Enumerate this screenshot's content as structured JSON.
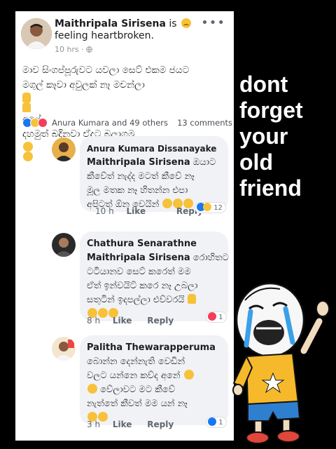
{
  "post": {
    "author": "Maithripala Sirisena",
    "feeling_prefix": "is",
    "feeling": "feeling heartbroken.",
    "time": "10 hrs · ",
    "more": "•••",
    "text_lines": [
      "මාව සිංගප්පූරුවට යවලා සෙට් එකම ජයට",
      "මගුල් කෑවා අවුලක් නෑ මචන්ලා",
      "දහමුත් බදිනවා ඒදට බලාගමු"
    ],
    "text_line2_tail": "අපේ",
    "reactors": "Anura Kumara and 49 others",
    "comment_count": "13 comments"
  },
  "comments": [
    {
      "author": "Anura Kumara Dissanayake",
      "tag": "Maithripala Sirisena",
      "tag_tail": "ඔයාට",
      "lines": [
        "කීවේත් නැද්ද මටත් කීවේ නෑ",
        "මූල මතක නෑ හිතන්න එපා",
        "අපිටත් ඕන වෙයින්"
      ],
      "time": "10 h",
      "like": "Like",
      "reply": "Reply",
      "reaction_count": "12"
    },
    {
      "author": "Chathura Senarathne",
      "tag": "Maithripala Sirisena",
      "tag_tail": "රොහිතට",
      "lines": [
        "ටටියානව සෙට් කරෙත් මම",
        "ඒත් ඉන්වයිට් කරෙ නෑ උබලා",
        "සතුටින් ඉදපල්ලා එව්වරයි"
      ],
      "time": "8 h",
      "like": "Like",
      "reply": "Reply",
      "reaction_count": "1"
    },
    {
      "author": "Palitha Thewarapperuma",
      "lines": [
        "බොන්න දෙන්නැති වෙඩින්",
        "වලට යන්නෙ කව්ද අනේ",
        "වේලාවට මට කීවේ",
        "නැත්තේ කීවත් මම යන් නෑ"
      ],
      "time": "3 h",
      "like": "Like",
      "reply": "Reply",
      "reaction_count": "1"
    }
  ],
  "caption": [
    "dont",
    "forget",
    "your",
    "old",
    "friend"
  ],
  "colors": {
    "facebook_blue": "#1877f2",
    "bubble": "#f1f2f6",
    "caption": "#ffffff"
  }
}
